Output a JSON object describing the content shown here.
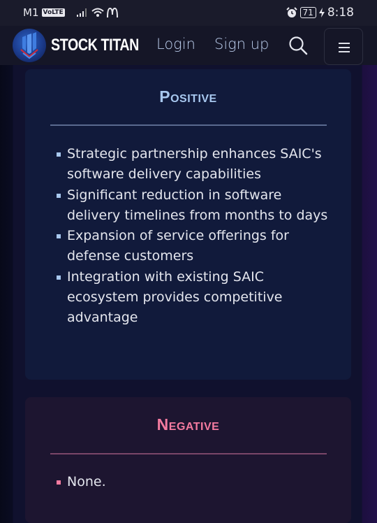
{
  "status_bar": {
    "carrier": "M1",
    "network_badge": "VoLTE",
    "signal_icon": "signal-bars-icon",
    "wifi_icon": "wifi-icon",
    "app_icon": "mcdonalds-icon",
    "alarm_icon": "alarm-icon",
    "battery_level": "71",
    "charging_icon": "bolt-icon",
    "time": "8:18"
  },
  "header": {
    "brand": "STOCK TITAN",
    "login_label": "Login",
    "signup_label": "Sign up",
    "search_icon": "search-icon",
    "menu_icon": "hamburger-menu-icon"
  },
  "positive": {
    "title": "Positive",
    "accent_color": "#a8c8ef",
    "items": [
      "Strategic partnership enhances SAIC's software delivery capabilities",
      "Significant reduction in software delivery timelines from months to days",
      "Expansion of service offerings for defense customers",
      "Integration with existing SAIC ecosystem provides competitive advantage"
    ]
  },
  "negative": {
    "title": "Negative",
    "accent_color": "#f47ba0",
    "items": [
      "None."
    ]
  }
}
